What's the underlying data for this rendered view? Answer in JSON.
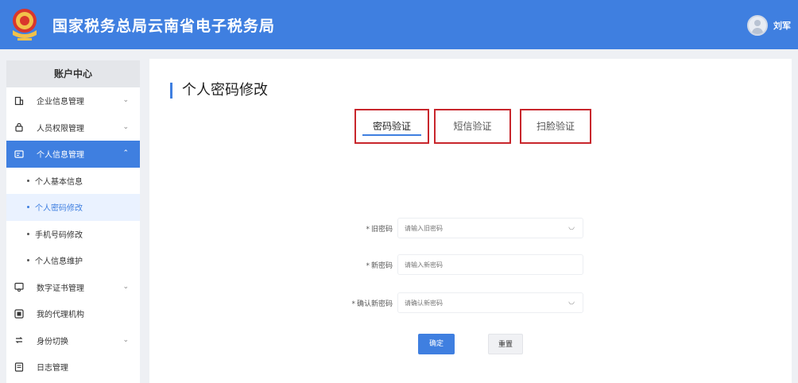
{
  "header": {
    "title": "国家税务总局云南省电子税务局",
    "user_name": "刘军",
    "brand_color": "#3f7fe0"
  },
  "sidebar": {
    "title": "账户中心",
    "items": [
      {
        "label": "企业信息管理",
        "icon": "building-icon",
        "expandable": true
      },
      {
        "label": "人员权限管理",
        "icon": "lock-icon",
        "expandable": true
      },
      {
        "label": "个人信息管理",
        "icon": "id-card-icon",
        "expandable": true,
        "expanded": true
      },
      {
        "label": "数字证书管理",
        "icon": "certificate-icon",
        "expandable": true
      },
      {
        "label": "我的代理机构",
        "icon": "agency-icon",
        "expandable": false
      },
      {
        "label": "身份切换",
        "icon": "switch-icon",
        "expandable": true
      },
      {
        "label": "日志管理",
        "icon": "log-icon",
        "expandable": false
      }
    ],
    "sub_items": [
      {
        "label": "个人基本信息"
      },
      {
        "label": "个人密码修改"
      },
      {
        "label": "手机号码修改"
      },
      {
        "label": "个人信息维护"
      }
    ]
  },
  "main": {
    "page_title": "个人密码修改",
    "tabs": [
      {
        "label": "密码验证",
        "selected": true
      },
      {
        "label": "短信验证",
        "selected": false
      },
      {
        "label": "扫脸验证",
        "selected": false
      }
    ],
    "form": {
      "fields": [
        {
          "label": "旧密码",
          "placeholder": "请输入旧密码"
        },
        {
          "label": "新密码",
          "placeholder": "请输入新密码"
        },
        {
          "label": "确认新密码",
          "placeholder": "请确认新密码"
        }
      ],
      "confirm_label": "确定",
      "reset_label": "重置"
    }
  },
  "colors": {
    "accent": "#3f7fe0",
    "tab_highlight_border": "#c8262c",
    "background": "#eef0f4"
  }
}
